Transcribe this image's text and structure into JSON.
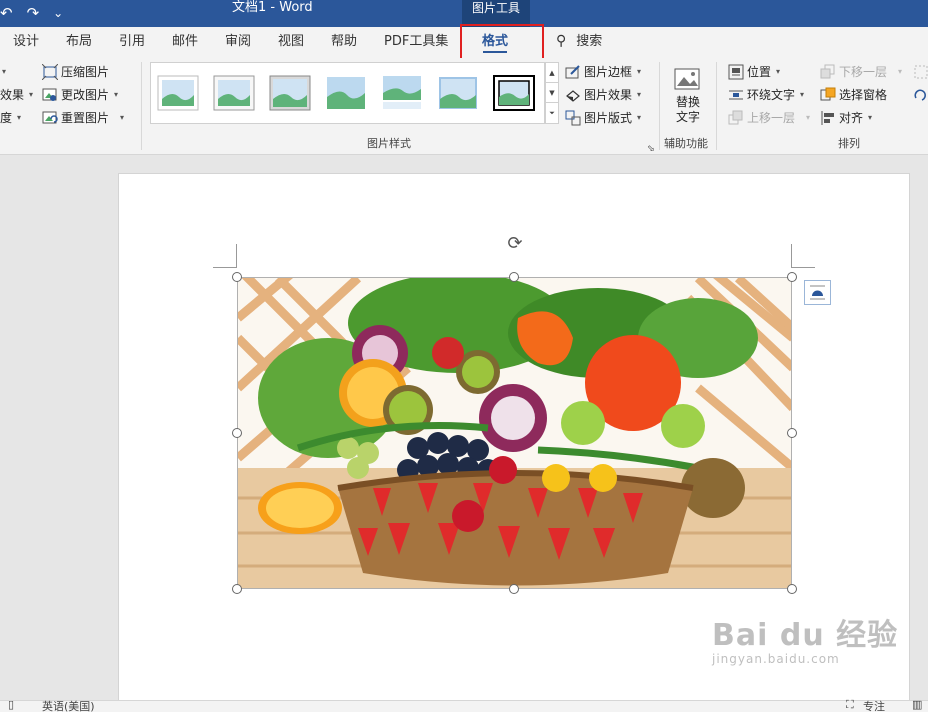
{
  "titlebar": {
    "qat": [
      "↶",
      "↷",
      "⌄"
    ],
    "doc_title": "文档1  -  Word",
    "context_tab": "图片工具"
  },
  "tabs": [
    "设计",
    "布局",
    "引用",
    "邮件",
    "审阅",
    "视图",
    "帮助",
    "PDF工具集",
    "格式",
    "搜索"
  ],
  "active_tab": "格式",
  "ribbon": {
    "adjust": {
      "effects_partial": "效果",
      "transparency_partial": "度",
      "compress": "压缩图片",
      "change": "更改图片",
      "reset": "重置图片"
    },
    "picture_styles": {
      "label": "图片样式",
      "border": "图片边框",
      "effects": "图片效果",
      "layout": "图片版式"
    },
    "accessibility": {
      "alt_text": "替换\n文字",
      "label": "辅助功能"
    },
    "arrange": {
      "position": "位置",
      "wrap_text": "环绕文字",
      "bring_forward": "上移一层",
      "send_backward": "下移一层",
      "selection_pane": "选择窗格",
      "align": "对齐",
      "label": "排列"
    }
  },
  "watermark": {
    "brand": "Bai du 经验",
    "url": "jingyan.baidu.com"
  },
  "statusbar": {
    "language": "英语(美国)",
    "focus": "专注"
  },
  "colors": {
    "title_blue": "#2b579a",
    "highlight_red": "#e02020"
  }
}
